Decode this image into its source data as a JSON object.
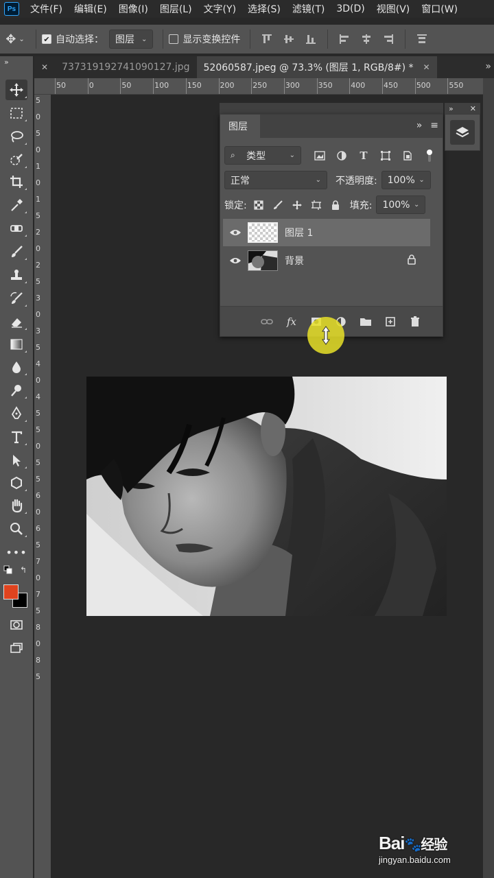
{
  "app": {
    "logo": "Ps"
  },
  "menu": [
    "文件(F)",
    "编辑(E)",
    "图像(I)",
    "图层(L)",
    "文字(Y)",
    "选择(S)",
    "滤镜(T)",
    "3D(D)",
    "视图(V)",
    "窗口(W)"
  ],
  "options": {
    "auto_select_label": "自动选择：",
    "auto_select_checked": true,
    "auto_select_target": "图层",
    "show_transform_label": "显示变换控件",
    "show_transform_checked": false
  },
  "tabs": [
    {
      "label": "737319192741090127.jpg",
      "active": false
    },
    {
      "label": "52060587.jpeg @ 73.3% (图层 1, RGB/8#) *",
      "active": true
    }
  ],
  "ruler_top": [
    "50",
    "0",
    "50",
    "100",
    "150",
    "200",
    "250",
    "300",
    "350",
    "400",
    "450",
    "500",
    "550"
  ],
  "ruler_left": [
    "5",
    "0",
    "5",
    "0",
    "1",
    "0",
    "1",
    "5",
    "2",
    "0",
    "2",
    "5",
    "3",
    "0",
    "3",
    "5",
    "4",
    "0",
    "4",
    "5",
    "5",
    "0",
    "5",
    "5",
    "6",
    "0",
    "6",
    "5",
    "7",
    "0",
    "7",
    "5",
    "8",
    "0",
    "8",
    "5"
  ],
  "layers_panel": {
    "tab_label": "图层",
    "filter_label": "类型",
    "blend_mode": "正常",
    "opacity_label": "不透明度:",
    "opacity_value": "100%",
    "lock_label": "锁定:",
    "fill_label": "填充:",
    "fill_value": "100%",
    "layers": [
      {
        "name": "图层 1",
        "selected": true,
        "locked": false
      },
      {
        "name": "背景",
        "selected": false,
        "locked": true
      }
    ]
  },
  "watermark": {
    "logo": "Bai",
    "logo_cn": "经验",
    "url": "jingyan.baidu.com"
  },
  "colors": {
    "foreground": "#e0431e",
    "background": "#000000",
    "accent": "#31a8ff"
  }
}
